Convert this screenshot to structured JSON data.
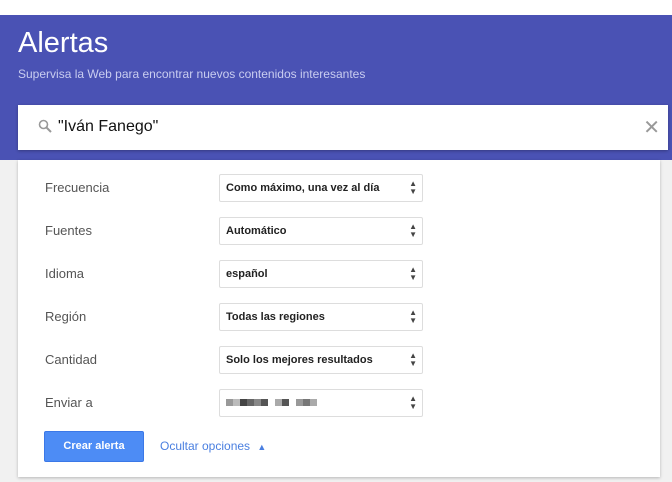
{
  "header": {
    "title": "Alertas",
    "subtitle": "Supervisa la Web para encontrar nuevos contenidos interesantes"
  },
  "search": {
    "value": "\"Iván Fanego\""
  },
  "options": [
    {
      "label": "Frecuencia",
      "value": "Como máximo, una vez al día"
    },
    {
      "label": "Fuentes",
      "value": "Automático"
    },
    {
      "label": "Idioma",
      "value": "español"
    },
    {
      "label": "Región",
      "value": "Todas las regiones"
    },
    {
      "label": "Cantidad",
      "value": "Solo los mejores resultados"
    },
    {
      "label": "Enviar a",
      "value": ""
    }
  ],
  "actions": {
    "create": "Crear alerta",
    "hide_options": "Ocultar opciones"
  },
  "colors": {
    "header": "#4a52b4",
    "button": "#4d8cf5",
    "link": "#4a7fe0"
  }
}
